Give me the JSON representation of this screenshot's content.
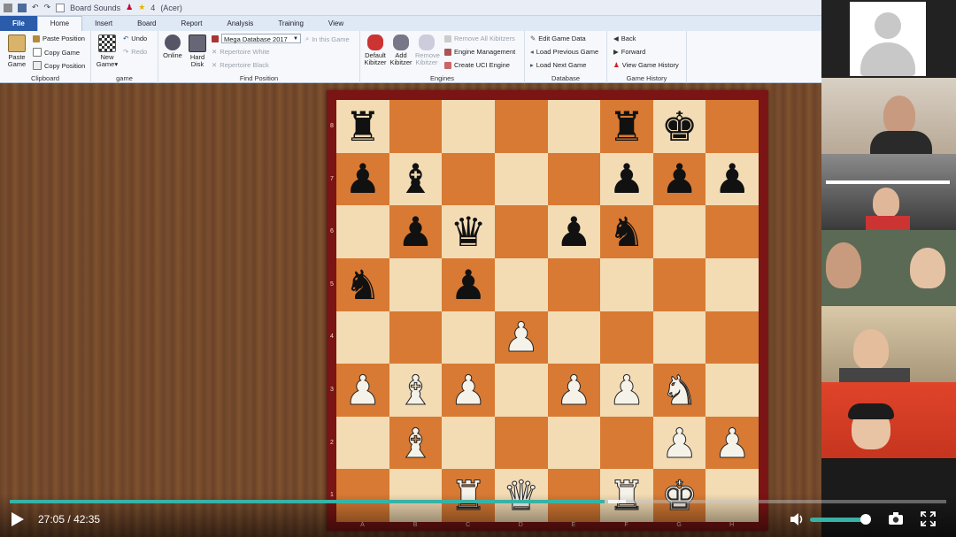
{
  "titlebar": {
    "qat": [
      "Board Sounds",
      "4",
      "(Acer)"
    ]
  },
  "tabs": [
    "File",
    "Home",
    "Insert",
    "Board",
    "Report",
    "Analysis",
    "Training",
    "View"
  ],
  "ribbon": {
    "clipboard": {
      "paste_game": "Paste Game",
      "paste_position": "Paste Position",
      "copy_game": "Copy Game",
      "copy_position": "Copy Position",
      "label": "Clipboard"
    },
    "game": {
      "new_game": "New Game",
      "undo": "Undo",
      "redo": "Redo",
      "label": "game"
    },
    "find_position": {
      "online": "Online",
      "hard_disk": "Hard Disk",
      "database": "Mega Database 2017",
      "in_this_game": "In this Game",
      "repertoire_white": "Repertoire White",
      "repertoire_black": "Repertoire Black",
      "label": "Find Position"
    },
    "engines": {
      "default_kibitzer": "Default Kibitzer",
      "add_kibitzer": "Add Kibitzer",
      "remove_kibitzer": "Remove Kibitzer",
      "remove_all": "Remove All Kibitzers",
      "engine_management": "Engine Management",
      "create_uci": "Create UCI Engine",
      "label": "Engines"
    },
    "database": {
      "edit_game_data": "Edit Game Data",
      "load_previous": "Load Previous Game",
      "load_next": "Load Next Game",
      "label": "Database"
    },
    "game_history": {
      "back": "Back",
      "forward": "Forward",
      "view_history": "View Game History",
      "label": "Game History"
    }
  },
  "board": {
    "ranks": [
      "8",
      "7",
      "6",
      "5",
      "4",
      "3",
      "2",
      "1"
    ],
    "files": [
      "A",
      "B",
      "C",
      "D",
      "E",
      "F",
      "G",
      "H"
    ],
    "rows": [
      [
        "r",
        "",
        "",
        "",
        "",
        "r",
        "k",
        ""
      ],
      [
        "p",
        "b",
        "",
        "",
        "",
        "p",
        "p",
        "p"
      ],
      [
        "",
        "p",
        "q",
        "",
        "p",
        "n",
        "",
        ""
      ],
      [
        "n",
        "",
        "p",
        "",
        "",
        "",
        "",
        ""
      ],
      [
        "",
        "",
        "",
        "P",
        "",
        "",
        "",
        ""
      ],
      [
        "P",
        "B",
        "P",
        "",
        "P",
        "P",
        "N",
        ""
      ],
      [
        "",
        "B",
        "",
        "",
        "",
        "",
        "P",
        "P"
      ],
      [
        "",
        "",
        "R",
        "Q",
        "",
        "R",
        "K",
        ""
      ]
    ]
  },
  "player": {
    "current": "27:05",
    "separator": "/",
    "duration": "42:35",
    "progress": 0.635,
    "volume": 0.95
  }
}
